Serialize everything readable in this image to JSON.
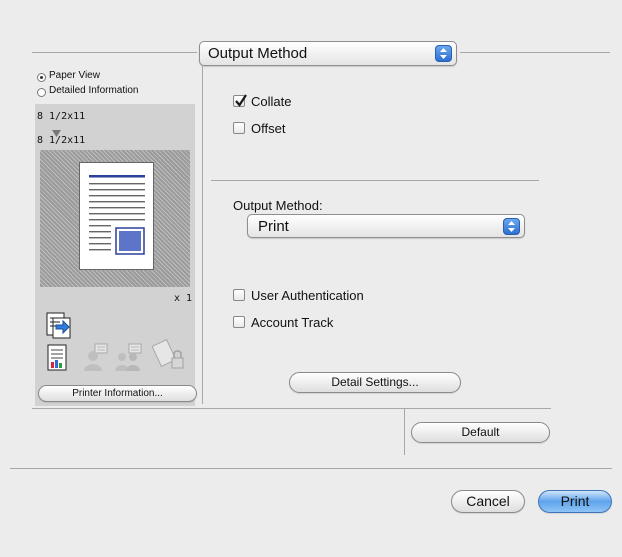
{
  "header": {
    "panel_popup": "Output Method"
  },
  "view_options": {
    "paper_view": "Paper View",
    "detailed_info": "Detailed Information",
    "selected": "paper_view"
  },
  "preview": {
    "source_size": "8 1/2x11",
    "output_size": "8 1/2x11",
    "copies": "x 1",
    "printer_info_button": "Printer Information..."
  },
  "options": {
    "collate": {
      "label": "Collate",
      "checked": true
    },
    "offset": {
      "label": "Offset",
      "checked": false
    },
    "output_method_label": "Output Method:",
    "output_method_value": "Print",
    "user_auth": {
      "label": "User Authentication",
      "checked": false
    },
    "account_track": {
      "label": "Account Track",
      "checked": false
    },
    "detail_settings_button": "Detail Settings..."
  },
  "footer": {
    "default_button": "Default",
    "cancel_button": "Cancel",
    "print_button": "Print"
  },
  "colors": {
    "accent_blue": "#2c6fd1",
    "page_lines": "#2b3f9a"
  }
}
